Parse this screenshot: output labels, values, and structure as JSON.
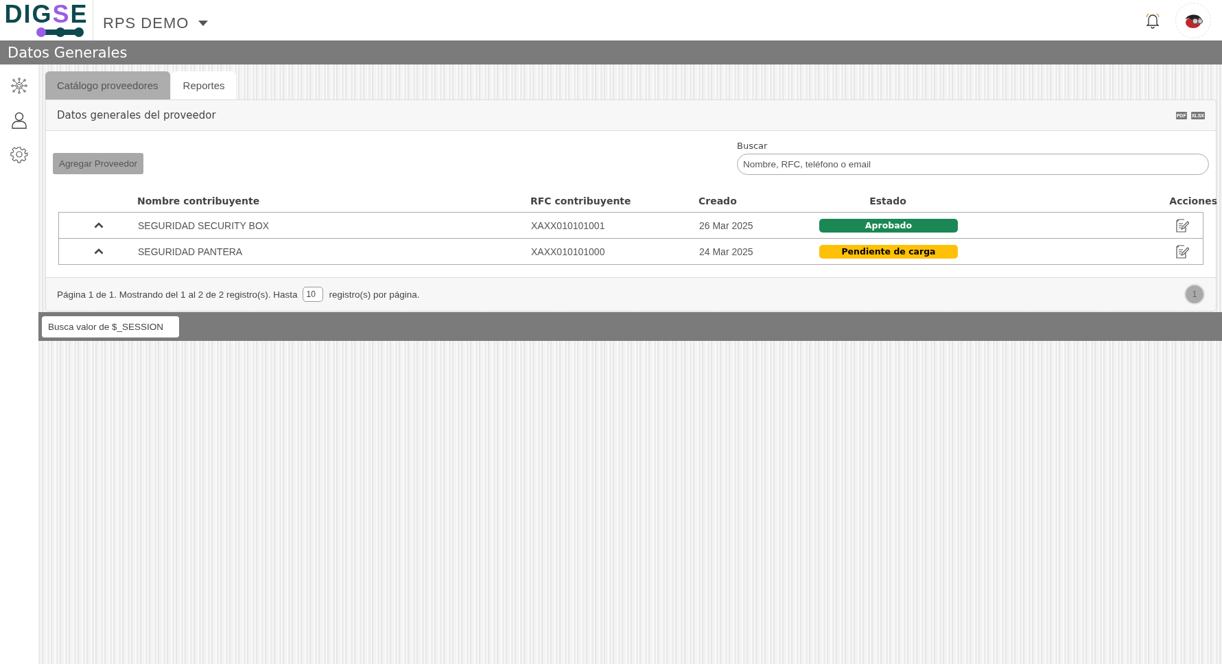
{
  "header": {
    "logo": [
      {
        "text": "DIG",
        "color": "#0d4a4f"
      },
      {
        "text": "S",
        "color": "#9b5de5"
      },
      {
        "text": "E",
        "color": "#0d4a4f"
      }
    ],
    "project": "RPS DEMO"
  },
  "title_bar": {
    "title": "Datos Generales"
  },
  "tabs": [
    {
      "label": "Catálogo proveedores",
      "selected": true
    },
    {
      "label": "Reportes",
      "selected": false
    }
  ],
  "card": {
    "title": "Datos generales del proveedor",
    "exports": [
      "PDF",
      "XLSX"
    ],
    "add_button": "Agregar Proveedor",
    "search": {
      "label": "Buscar",
      "placeholder": "Nombre, RFC, teléfono o email"
    }
  },
  "table": {
    "columns": [
      "Nombre contribuyente",
      "RFC contribuyente",
      "Creado",
      "Estado",
      "Acciones"
    ],
    "rows": [
      {
        "name": "SEGURIDAD SECURITY BOX",
        "rfc": "XAXX010101001",
        "created": "26 Mar 2025",
        "status": "Aprobado",
        "color": "#1a8754"
      },
      {
        "name": "SEGURIDAD PANTERA",
        "rfc": "XAXX010101000",
        "created": "24 Mar 2025",
        "status": "Pendiente de carga",
        "color": "#ffc107"
      }
    ]
  },
  "footer": {
    "text_before": "Página 1 de 1. Mostrando del 1 al 2 de 2 registro(s). Hasta",
    "page_size": "10",
    "text_after": "registro(s) por página.",
    "pages": [
      {
        "label": "1",
        "selected": true
      }
    ]
  },
  "session": {
    "placeholder": "Busca valor de $_SESSION"
  }
}
